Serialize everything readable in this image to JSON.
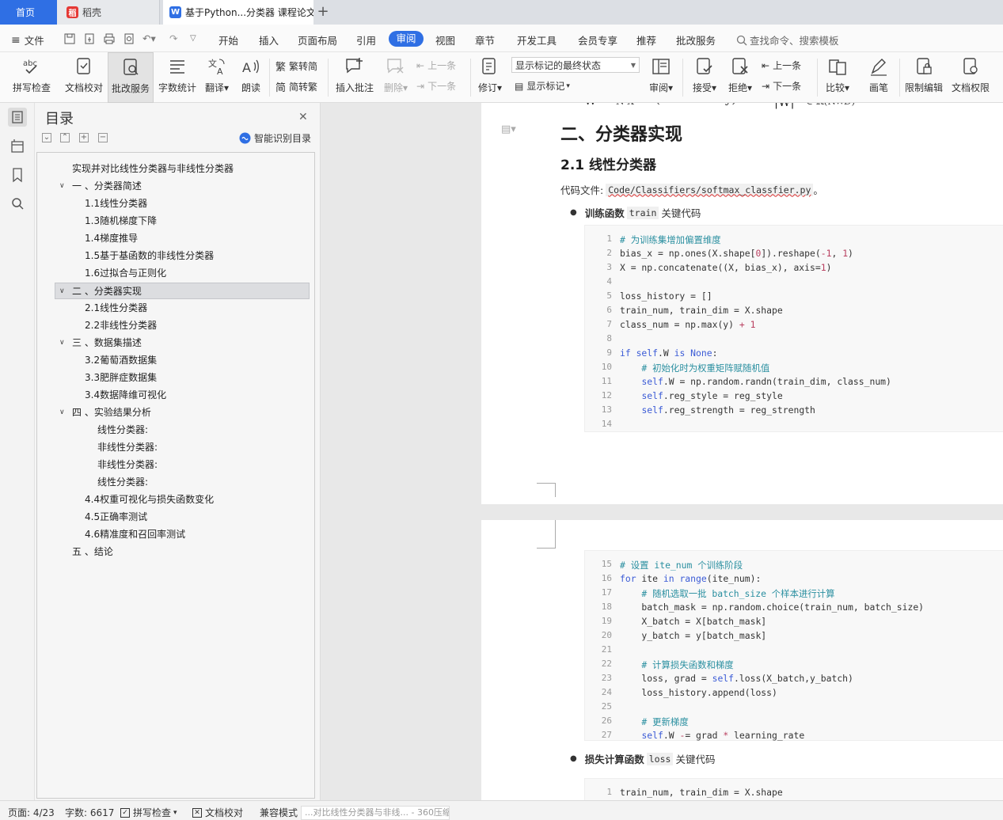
{
  "tabs": {
    "home": "首页",
    "daoke": "稻壳",
    "doc": "基于Python...分类器 课程论文"
  },
  "menu": {
    "file": "文件",
    "items": [
      "开始",
      "插入",
      "页面布局",
      "引用",
      "审阅",
      "视图",
      "章节",
      "开发工具",
      "会员专享",
      "推荐",
      "批改服务"
    ],
    "search": "查找命令、搜索模板"
  },
  "ribbon": {
    "spell": "拼写检查",
    "proof": "文档校对",
    "correct": "批改服务",
    "wordcount": "字数统计",
    "translate": "翻译",
    "read": "朗读",
    "trad_to_simp": "繁转简",
    "simp_to_trad": "简转繁",
    "insert_comment": "插入批注",
    "delete": "删除",
    "prev_comment": "上一条",
    "next_comment": "下一条",
    "revise": "修订",
    "markup_state": "显示标记的最终状态",
    "show_markup": "显示标记",
    "review": "审阅",
    "accept": "接受",
    "reject": "拒绝",
    "prev_change": "上一条",
    "next_change": "下一条",
    "compare": "比较",
    "ink": "画笔",
    "restrict": "限制编辑",
    "permission": "文档权限"
  },
  "toc": {
    "title": "目录",
    "smart": "智能识别目录",
    "items": [
      {
        "text": "实现并对比线性分类器与非线性分类器"
      },
      {
        "text": "一 、分类器简述"
      },
      {
        "text": "1.1线性分类器"
      },
      {
        "text": "1.3随机梯度下降"
      },
      {
        "text": "1.4梯度推导"
      },
      {
        "text": "1.5基于基函数的非线性分类器"
      },
      {
        "text": "1.6过拟合与正则化"
      },
      {
        "text": "二 、分类器实现"
      },
      {
        "text": "2.1线性分类器"
      },
      {
        "text": "2.2非线性分类器"
      },
      {
        "text": "三 、数据集描述"
      },
      {
        "text": "3.2葡萄酒数据集"
      },
      {
        "text": "3.3肥胖症数据集"
      },
      {
        "text": "3.4数据降维可视化"
      },
      {
        "text": "四 、实验结果分析"
      },
      {
        "text": "线性分类器:"
      },
      {
        "text": "非线性分类器:"
      },
      {
        "text": "非线性分类器:"
      },
      {
        "text": "线性分类器:"
      },
      {
        "text": "4.4权重可视化与损失函数变化"
      },
      {
        "text": "4.5正确率测试"
      },
      {
        "text": "4.6精准度和召回率测试"
      },
      {
        "text": "五 、结论"
      }
    ]
  },
  "doc": {
    "h2": "二、分类器实现",
    "h3": "2.1 线性分类器",
    "codefile_label": "代码文件:",
    "codefile": "Code/Classifiers/softmax_classfier.py",
    "codefile_end": "。",
    "bullet1_bold": "训练函数",
    "bullet1_code": "train",
    "bullet1_tail": "关键代码",
    "code1": [
      {
        "n": "1",
        "t": "# 为训练集增加偏置维度"
      },
      {
        "n": "2",
        "t": "bias_x = np.ones(X.shape[0]).reshape(-1, 1)"
      },
      {
        "n": "3",
        "t": "X = np.concatenate((X, bias_x), axis=1)"
      },
      {
        "n": "4",
        "t": ""
      },
      {
        "n": "5",
        "t": "loss_history = []"
      },
      {
        "n": "6",
        "t": "train_num, train_dim = X.shape"
      },
      {
        "n": "7",
        "t": "class_num = np.max(y) + 1"
      },
      {
        "n": "8",
        "t": ""
      },
      {
        "n": "9",
        "t": "if self.W is None:"
      },
      {
        "n": "10",
        "t": "    # 初始化时为权重矩阵赋随机值"
      },
      {
        "n": "11",
        "t": "    self.W = np.random.randn(train_dim, class_num)"
      },
      {
        "n": "12",
        "t": "    self.reg_style = reg_style"
      },
      {
        "n": "13",
        "t": "    self.reg_strength = reg_strength"
      },
      {
        "n": "14",
        "t": ""
      }
    ],
    "code2": [
      {
        "n": "15",
        "t": "# 设置 ite_num 个训练阶段"
      },
      {
        "n": "16",
        "t": "for ite in range(ite_num):"
      },
      {
        "n": "17",
        "t": "    # 随机选取一批 batch_size 个样本进行计算"
      },
      {
        "n": "18",
        "t": "    batch_mask = np.random.choice(train_num, batch_size)"
      },
      {
        "n": "19",
        "t": "    X_batch = X[batch_mask]"
      },
      {
        "n": "20",
        "t": "    y_batch = y[batch_mask]"
      },
      {
        "n": "21",
        "t": ""
      },
      {
        "n": "22",
        "t": "    # 计算损失函数和梯度"
      },
      {
        "n": "23",
        "t": "    loss, grad = self.loss(X_batch,y_batch)"
      },
      {
        "n": "24",
        "t": "    loss_history.append(loss)"
      },
      {
        "n": "25",
        "t": ""
      },
      {
        "n": "26",
        "t": "    # 更新梯度"
      },
      {
        "n": "27",
        "t": "    self.W -= grad * learning_rate"
      }
    ],
    "bullet2_bold": "损失计算函数",
    "bullet2_code": "loss",
    "bullet2_tail": "关键代码",
    "code3": [
      {
        "n": "1",
        "t": "train_num, train_dim = X.shape"
      }
    ]
  },
  "status": {
    "page": "页面: 4/23",
    "words": "字数: 6617",
    "spell": "拼写检查",
    "proof": "文档校对",
    "compat": "兼容模式",
    "window_title": "...对比线性分类器与非线... - 360压缩"
  },
  "colors": {
    "accent": "#2f6fe4",
    "code_comment": "#2a8fa0",
    "code_keyword": "#3b5bd6"
  }
}
